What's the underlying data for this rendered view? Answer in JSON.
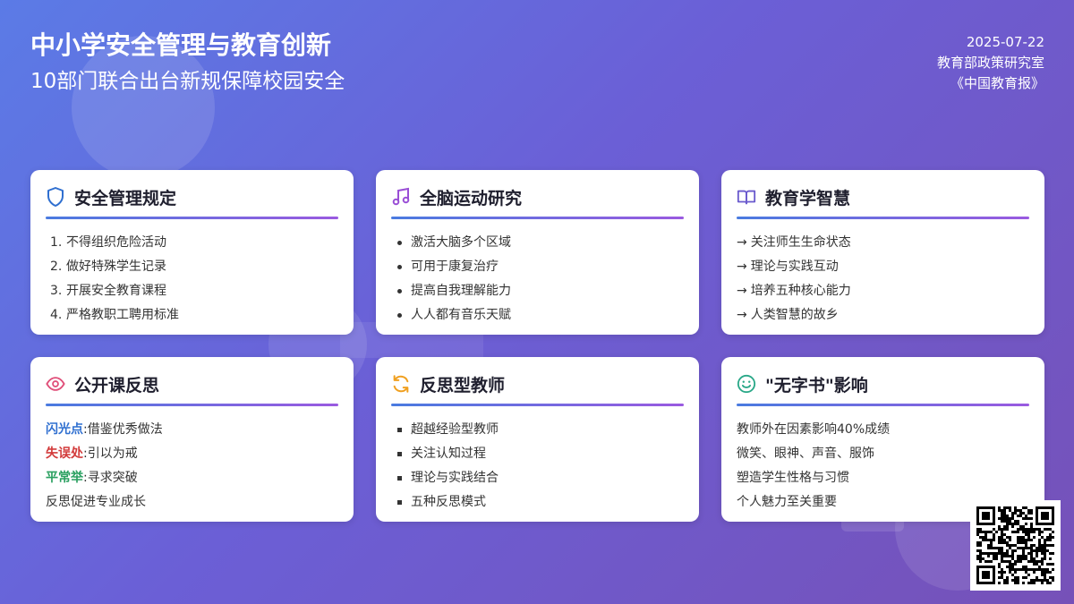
{
  "header": {
    "title": "中小学安全管理与教育创新",
    "subtitle": "10部门联合出台新规保障校园安全"
  },
  "meta": {
    "date": "2025-07-22",
    "org": "教育部政策研究室",
    "source": "《中国教育报》"
  },
  "cards": [
    {
      "title": "安全管理规定",
      "icon": "shield-icon",
      "items": [
        "不得组织危险活动",
        "做好特殊学生记录",
        "开展安全教育课程",
        "严格教职工聘用标准"
      ],
      "numbers": [
        "1.",
        "2.",
        "3.",
        "4."
      ]
    },
    {
      "title": "全脑运动研究",
      "icon": "music-note-icon",
      "items": [
        "激活大脑多个区域",
        "可用于康复治疗",
        "提高自我理解能力",
        "人人都有音乐天赋"
      ]
    },
    {
      "title": "教育学智慧",
      "icon": "open-book-icon",
      "arrow": "→",
      "items": [
        "关注师生生命状态",
        "理论与实践互动",
        "培养五种核心能力",
        "人类智慧的故乡"
      ]
    },
    {
      "title": "公开课反思",
      "icon": "eye-icon",
      "items": [
        {
          "key": "闪光点",
          "sep": ": ",
          "text": "借鉴优秀做法"
        },
        {
          "key": "失误处",
          "sep": ": ",
          "text": "引以为戒"
        },
        {
          "key": "平常举",
          "sep": ": ",
          "text": "寻求突破"
        },
        {
          "key": "",
          "sep": "",
          "text": "反思促进专业成长"
        }
      ]
    },
    {
      "title": "反思型教师",
      "icon": "refresh-icon",
      "items": [
        "超越经验型教师",
        "关注认知过程",
        "理论与实践结合",
        "五种反思模式"
      ]
    },
    {
      "title": "\"无字书\"影响",
      "icon": "smile-icon",
      "items": [
        "教师外在因素影响40%成绩",
        "微笑、眼神、声音、服饰",
        "塑造学生性格与习惯",
        "个人魅力至关重要"
      ]
    }
  ],
  "colors": {
    "icon_blue": "#2f6fd0",
    "icon_purple": "#9a4fd6",
    "icon_book": "#6a5acd",
    "icon_pink": "#e0507a",
    "icon_orange": "#f0a020",
    "icon_green": "#2aa888"
  }
}
